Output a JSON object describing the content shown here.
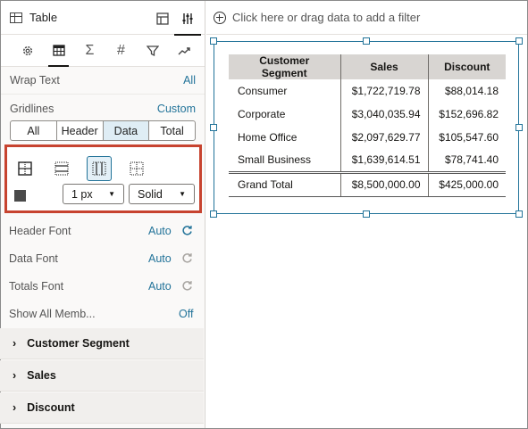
{
  "panel": {
    "title": "Table",
    "tabs": [
      "general-icon",
      "table-icon",
      "sum-icon",
      "hash-icon",
      "filter-icon",
      "trend-icon"
    ],
    "wrap_text": {
      "label": "Wrap Text",
      "value": "All"
    },
    "gridlines": {
      "label": "Gridlines",
      "value": "Custom"
    },
    "grid_scope": {
      "options": [
        "All",
        "Header",
        "Data",
        "Total"
      ],
      "selected": "Data"
    },
    "line_width": "1 px",
    "line_style": "Solid",
    "line_color": "#4a4a4a",
    "header_font": {
      "label": "Header Font",
      "value": "Auto"
    },
    "data_font": {
      "label": "Data Font",
      "value": "Auto"
    },
    "totals_font": {
      "label": "Totals Font",
      "value": "Auto"
    },
    "show_all": {
      "label": "Show All Memb...",
      "value": "Off"
    },
    "sections": [
      "Customer Segment",
      "Sales",
      "Discount"
    ]
  },
  "canvas": {
    "filter_placeholder": "Click here or drag data to add a filter",
    "table": {
      "columns": [
        "Customer Segment",
        "Sales",
        "Discount"
      ],
      "rows": [
        [
          "Consumer",
          "$1,722,719.78",
          "$88,014.18"
        ],
        [
          "Corporate",
          "$3,040,035.94",
          "$152,696.82"
        ],
        [
          "Home Office",
          "$2,097,629.77",
          "$105,547.60"
        ],
        [
          "Small Business",
          "$1,639,614.51",
          "$78,741.40"
        ]
      ],
      "total": [
        "Grand Total",
        "$8,500,000.00",
        "$425,000.00"
      ]
    }
  },
  "colors": {
    "accent": "#227399",
    "highlight": "#c7432f",
    "selected_segment": "#dfedf5"
  }
}
